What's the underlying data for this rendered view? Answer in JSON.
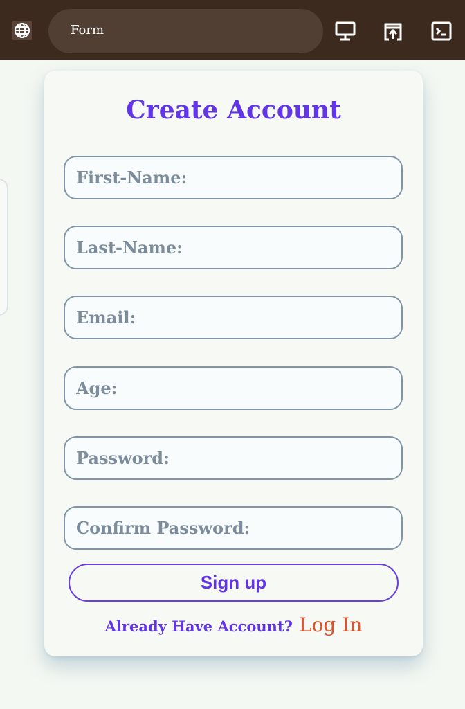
{
  "browser": {
    "tab_title": "Form",
    "icons": [
      "globe-icon",
      "monitor-icon",
      "share-icon",
      "terminal-icon"
    ]
  },
  "form": {
    "title": "Create Account",
    "fields": {
      "first_name": {
        "placeholder": "First-Name:",
        "value": ""
      },
      "last_name": {
        "placeholder": "Last-Name:",
        "value": ""
      },
      "email": {
        "placeholder": "Email:",
        "value": ""
      },
      "age": {
        "placeholder": "Age:",
        "value": ""
      },
      "password": {
        "placeholder": "Password:",
        "value": ""
      },
      "confirm_password": {
        "placeholder": "Confirm Password:",
        "value": ""
      }
    },
    "submit_label": "Sign up",
    "footer_text": "Already Have Account?",
    "login_link": "Log In"
  },
  "colors": {
    "accent": "#6236e6",
    "link": "#e0502a",
    "topbar": "#3d2a1e",
    "background": "#f4f8f2"
  }
}
